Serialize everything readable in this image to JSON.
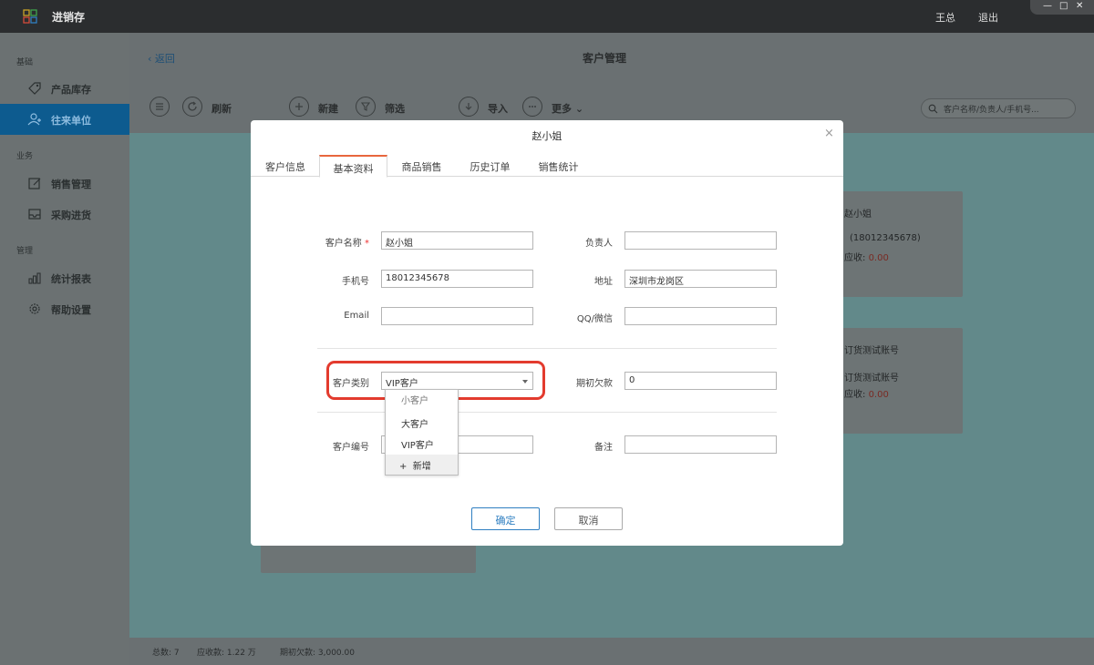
{
  "app": {
    "title": "进销存",
    "user": "王总",
    "logout": "退出",
    "window_controls": [
      "—",
      "□",
      "✕"
    ]
  },
  "sidebar": {
    "sections": [
      {
        "label": "基础",
        "items": [
          {
            "label": "产品库存",
            "icon": "tag-icon"
          },
          {
            "label": "往来单位",
            "icon": "contacts-icon",
            "active": true
          }
        ]
      },
      {
        "label": "业务",
        "items": [
          {
            "label": "销售管理",
            "icon": "edit-icon"
          },
          {
            "label": "采购进货",
            "icon": "inbox-icon"
          }
        ]
      },
      {
        "label": "管理",
        "items": [
          {
            "label": "统计报表",
            "icon": "bar-chart-icon"
          },
          {
            "label": "帮助设置",
            "icon": "gear-icon"
          }
        ]
      }
    ]
  },
  "main": {
    "back": "返回",
    "page_title": "客户管理",
    "toolbar": {
      "refresh": "刷新",
      "new": "新建",
      "filter": "筛选",
      "import": "导入",
      "more": "更多"
    },
    "search_placeholder": "客户名称/负责人/手机号...",
    "cards": [
      {
        "name": "赵小姐",
        "phone": "(18012345678)",
        "receivable_label": "应收:",
        "receivable_value": "0.00"
      },
      {
        "name": "订货测试账号",
        "sub": "订货测试账号",
        "receivable_label": "应收:",
        "receivable_value": "0.00"
      }
    ],
    "footer": {
      "total": "总数: 7",
      "receivable": "应收款: 1.22 万",
      "initial_debt": "期初欠款: 3,000.00"
    }
  },
  "modal": {
    "title": "赵小姐",
    "tabs": [
      "客户信息",
      "基本资料",
      "商品销售",
      "历史订单",
      "销售统计"
    ],
    "active_tab": 1,
    "fields": {
      "name_label": "客户名称",
      "name_required": "*",
      "name_value": "赵小姐",
      "owner_label": "负责人",
      "owner_value": "",
      "phone_label": "手机号",
      "phone_value": "18012345678",
      "address_label": "地址",
      "address_value": "深圳市龙岗区",
      "email_label": "Email",
      "email_value": "",
      "qq_label": "QQ/微信",
      "qq_value": "",
      "category_label": "客户类别",
      "category_value": "VIP客户",
      "initial_debt_label": "期初欠款",
      "initial_debt_value": "0",
      "code_label": "客户编号",
      "code_value": "",
      "remark_label": "备注",
      "remark_value": ""
    },
    "dropdown_options": [
      "小客户",
      "大客户",
      "VIP客户"
    ],
    "dropdown_add": "新增",
    "confirm": "确定",
    "cancel": "取消"
  },
  "colors": {
    "accent_tab": "#e8663d",
    "primary_button": "#2f7fc1",
    "highlight_ring": "#e33b2e",
    "active_sidebar": "#0d5b8f"
  }
}
